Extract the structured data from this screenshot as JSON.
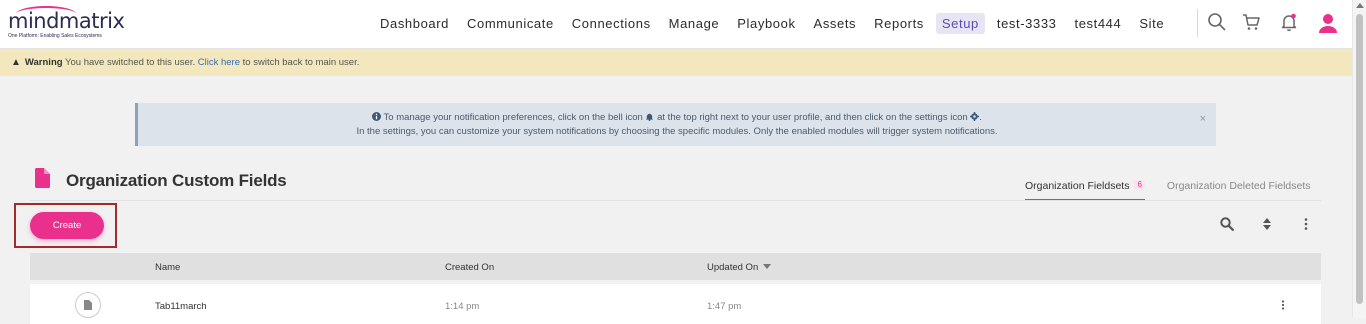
{
  "brand": {
    "name": "mindmatrix",
    "tagline": "One Platform: Enabling Sales Ecosystems",
    "accent": "#e8308c"
  },
  "nav": {
    "items": [
      {
        "label": "Dashboard"
      },
      {
        "label": "Communicate"
      },
      {
        "label": "Connections"
      },
      {
        "label": "Manage"
      },
      {
        "label": "Playbook"
      },
      {
        "label": "Assets"
      },
      {
        "label": "Reports"
      },
      {
        "label": "Setup",
        "active": true
      },
      {
        "label": "test-3333"
      },
      {
        "label": "test444"
      },
      {
        "label": "Site"
      }
    ],
    "icons": [
      "search-icon",
      "cart-icon",
      "bell-icon",
      "user-icon"
    ]
  },
  "warning": {
    "prefix": "Warning",
    "text1": "You have switched to this user.",
    "link": "Click here",
    "text2": "to switch back to main user."
  },
  "info": {
    "line1_a": "To manage your notification preferences, click on the bell icon",
    "line1_b": "at the top right next to your user profile, and then click on the settings icon",
    "line1_c": ".",
    "line2": "In the settings, you can customize your system notifications by choosing the specific modules. Only the enabled modules will trigger system notifications.",
    "close": "×"
  },
  "page": {
    "title": "Organization Custom Fields",
    "tabs": [
      {
        "label": "Organization Fieldsets",
        "count": "6",
        "active": true
      },
      {
        "label": "Organization Deleted Fieldsets"
      }
    ],
    "create_label": "Create"
  },
  "table": {
    "columns": [
      "Name",
      "Created On",
      "Updated On"
    ],
    "sorted_column": "Updated On",
    "rows": [
      {
        "name": "Tab11march",
        "created": "1:14 pm",
        "updated": "1:47 pm"
      }
    ]
  }
}
